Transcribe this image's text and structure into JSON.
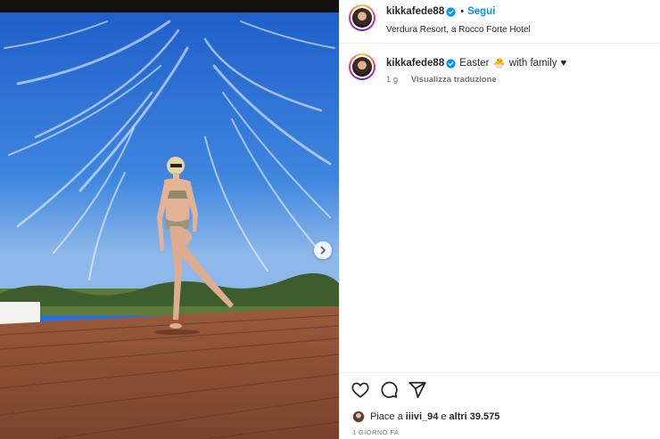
{
  "post": {
    "username": "kikkafede88",
    "separator": "•",
    "follow_label": "Segui",
    "location": "Verdura Resort, a Rocco Forte Hotel"
  },
  "caption": {
    "username": "kikkafede88",
    "text_before": "Easter",
    "emoji": "🐣",
    "text_after": "with family",
    "heart": "♥",
    "age": "1 g",
    "translate_label": "Visualizza traduzione"
  },
  "likes": {
    "prefix": "Piace a ",
    "liker": "iiivi_94",
    "middle": " e ",
    "others": "altri 39.575"
  },
  "timestamp": "1 GIORNO FA",
  "icons": {
    "verified": "verified-badge-icon",
    "like": "heart-icon",
    "comment": "comment-icon",
    "share": "share-icon",
    "next": "chevron-right-icon"
  },
  "colors": {
    "accent": "#0095f6",
    "muted": "#737373",
    "text": "#262626"
  }
}
